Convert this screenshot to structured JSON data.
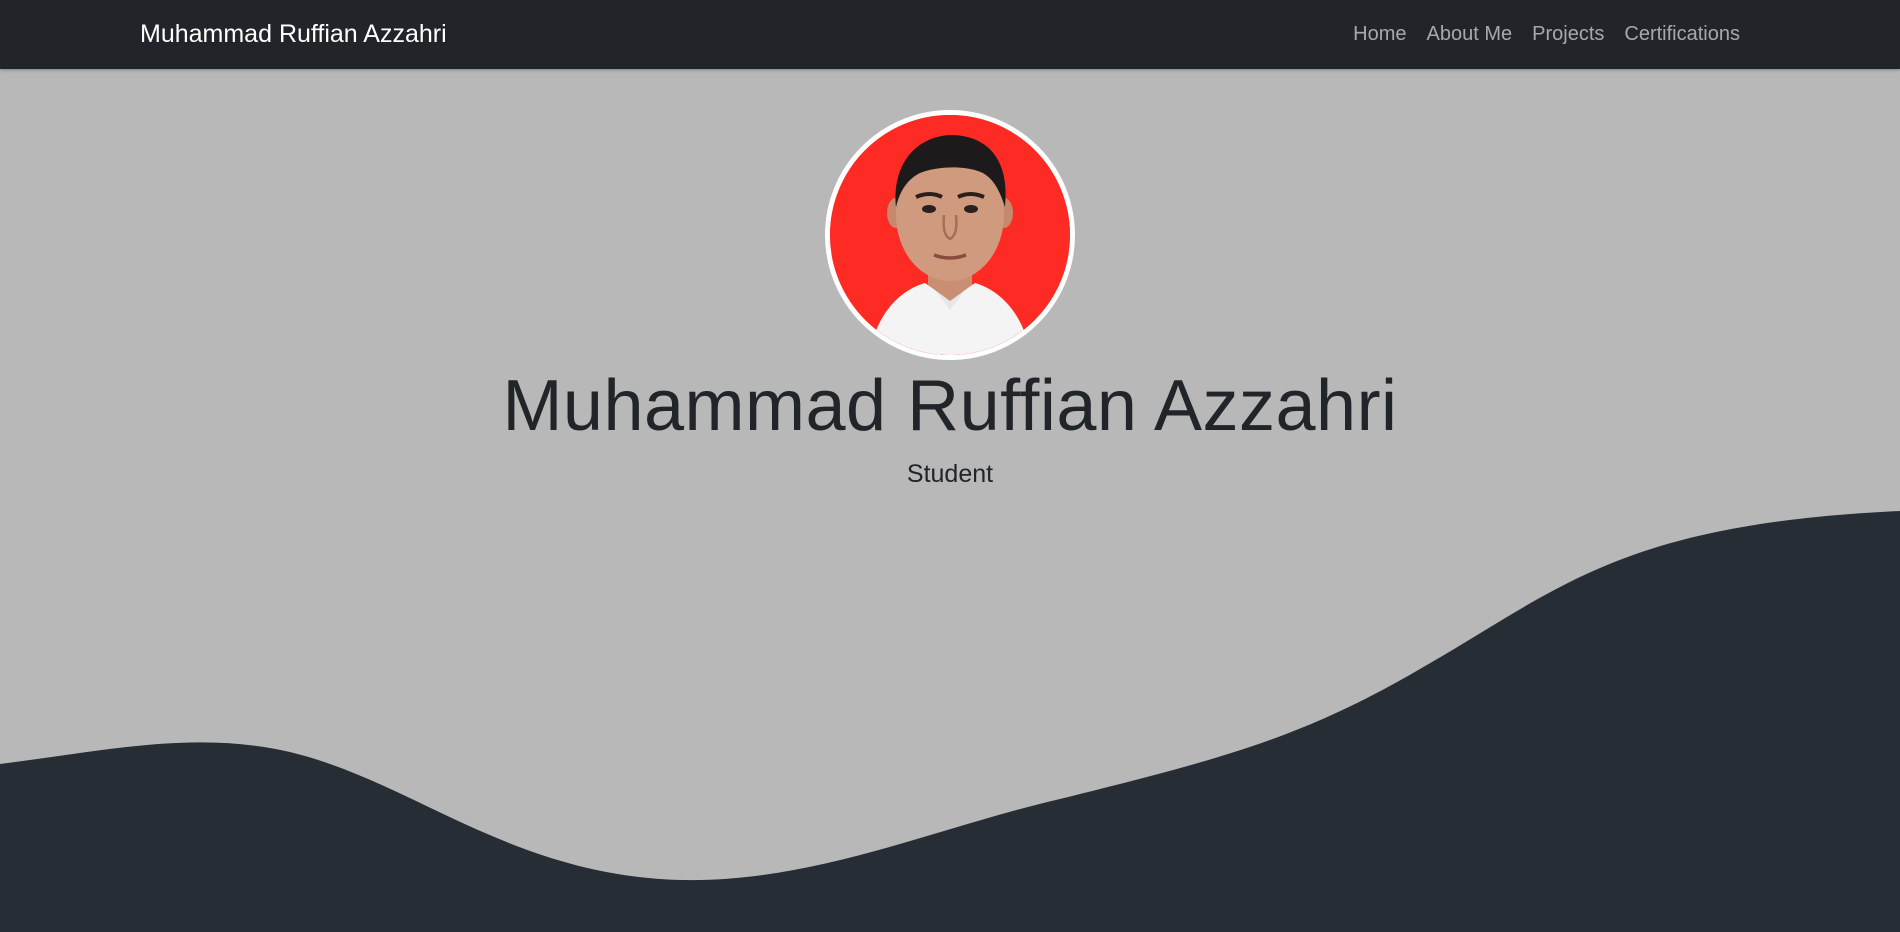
{
  "navbar": {
    "brand": "Muhammad Ruffian Azzahri",
    "links": [
      {
        "label": "Home"
      },
      {
        "label": "About Me"
      },
      {
        "label": "Projects"
      },
      {
        "label": "Certifications"
      }
    ]
  },
  "hero": {
    "title": "Muhammad Ruffian Azzahri",
    "subtitle": "Student",
    "avatar_background": "#fe2a24"
  },
  "colors": {
    "navbar_bg": "#212529",
    "hero_bg": "#b8b8b8",
    "wave": "#272d35"
  }
}
